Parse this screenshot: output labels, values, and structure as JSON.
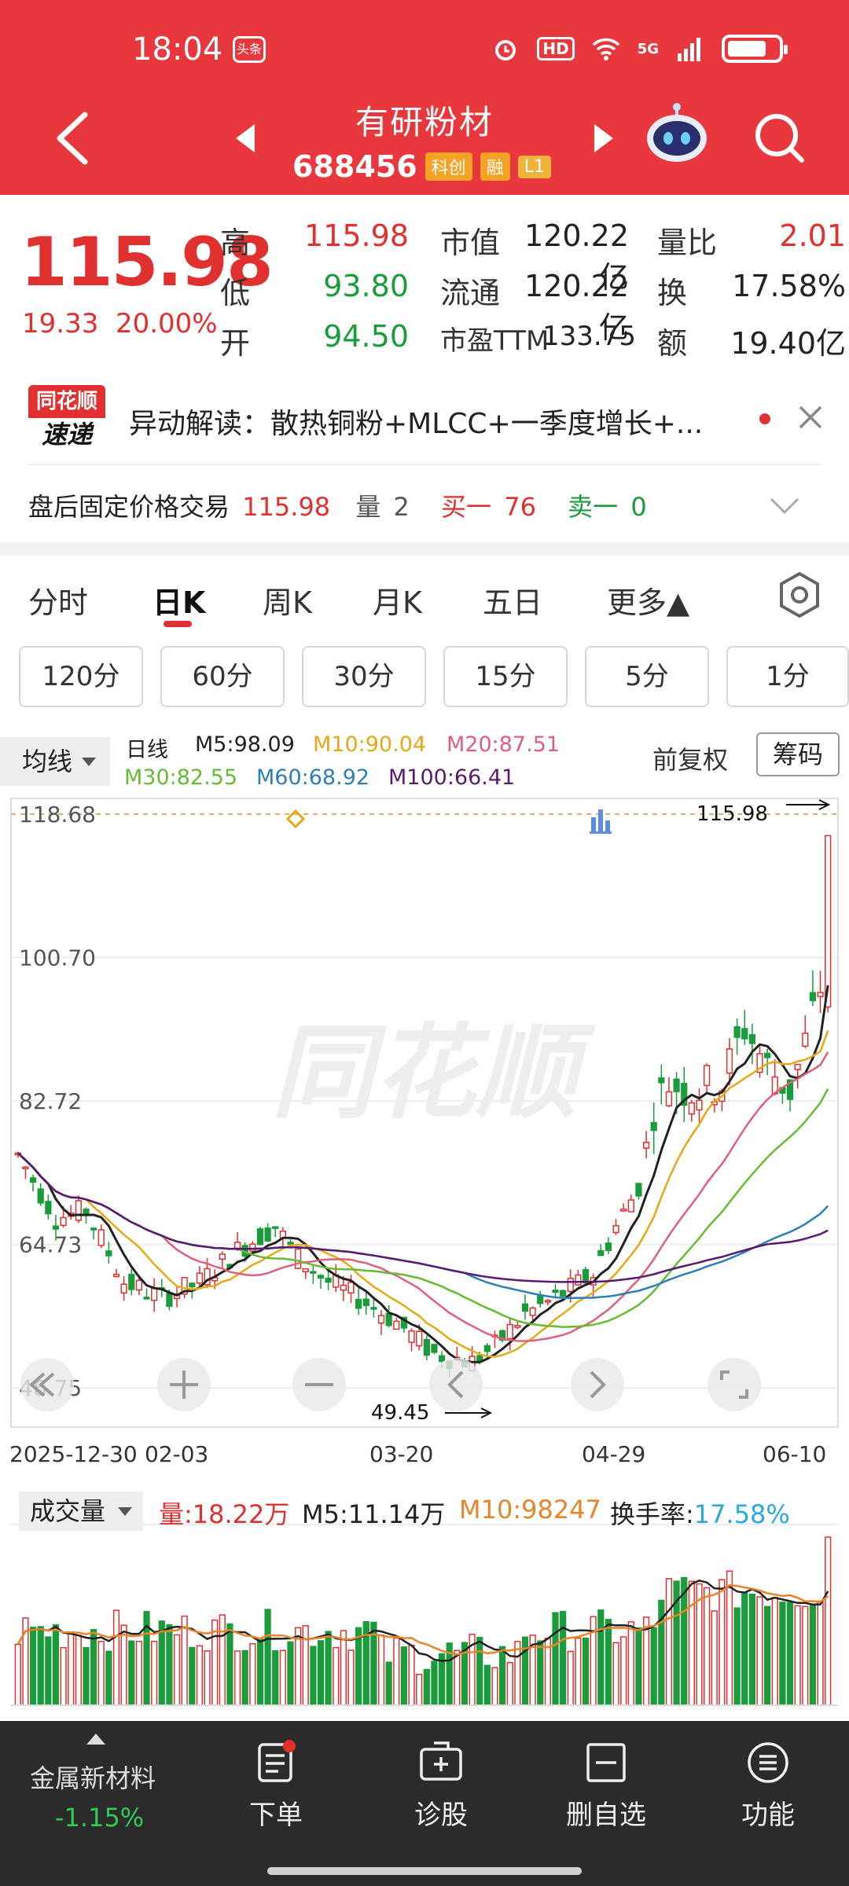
{
  "status": {
    "time": "18:04",
    "badge": "头条",
    "hd": "HD",
    "network": "5G"
  },
  "header": {
    "name": "有研粉材",
    "code": "688456",
    "tags": [
      "科创",
      "融",
      "L1"
    ]
  },
  "quote": {
    "price": "115.98",
    "change": "19.33",
    "change_pct": "20.00%",
    "stats": [
      {
        "label": "高",
        "value": "115.98",
        "color": "red"
      },
      {
        "label": "低",
        "value": "93.80",
        "color": "green"
      },
      {
        "label": "开",
        "value": "94.50",
        "color": "green"
      }
    ],
    "fund": [
      {
        "label": "市值",
        "value": "120.22亿"
      },
      {
        "label": "流通",
        "value": "120.22亿"
      },
      {
        "label": "市盈TTM",
        "value": "133.75"
      }
    ],
    "ratio": [
      {
        "label": "量比",
        "value": "2.01",
        "color": "red"
      },
      {
        "label": "换",
        "value": "17.58%",
        "color": "dark"
      },
      {
        "label": "额",
        "value": "19.40亿",
        "color": "dark"
      }
    ]
  },
  "news": {
    "logo_top": "同花顺",
    "logo_bottom": "速递",
    "text": "异动解读：散热铜粉+MLCC+一季度增长+..."
  },
  "afterhours": {
    "label": "盘后固定价格交易",
    "price": "115.98",
    "vol_label": "量",
    "vol": "2",
    "buy_label": "买一",
    "buy": "76",
    "sell_label": "卖一",
    "sell": "0"
  },
  "tabs": [
    "分时",
    "日K",
    "周K",
    "月K",
    "五日",
    "更多▲"
  ],
  "active_tab": 1,
  "periods": [
    "120分",
    "60分",
    "30分",
    "15分",
    "5分",
    "1分"
  ],
  "ma": {
    "selector": "均线",
    "line_type": "日线",
    "items": [
      {
        "label": "M5:98.09",
        "color": "#222222"
      },
      {
        "label": "M10:90.04",
        "color": "#e6a817"
      },
      {
        "label": "M20:87.51",
        "color": "#e0607a"
      },
      {
        "label": "M30:82.55",
        "color": "#66bb33"
      },
      {
        "label": "M60:68.92",
        "color": "#2e7fb8"
      },
      {
        "label": "M100:66.41",
        "color": "#5a1a6e"
      }
    ],
    "adjust": "前复权",
    "chips": "筹码"
  },
  "chart_data": {
    "type": "candlestick",
    "y_ticks": [
      "118.68",
      "100.70",
      "82.72",
      "64.73",
      "46.75"
    ],
    "ylim": [
      46.75,
      118.68
    ],
    "x_ticks": [
      "2025-12-30",
      "02-03",
      "03-20",
      "04-29",
      "06-10"
    ],
    "annotations": {
      "high_label": "115.98",
      "low_label": "49.45"
    },
    "watermark": "同花顺",
    "volume": {
      "selector": "成交量",
      "vol_label": "量:18.22万",
      "m5_label": "M5:11.14万",
      "m10_label": "M10:98247",
      "turnover_label": "换手率:",
      "turnover_value": "17.58%"
    }
  },
  "bottom_nav": {
    "sector_name": "金属新材料",
    "sector_change": "-1.15%",
    "items": [
      "下单",
      "诊股",
      "删自选",
      "功能"
    ]
  },
  "colors": {
    "header_red": "#e8383d",
    "up": "#e0302f",
    "down": "#1a9c3c"
  }
}
